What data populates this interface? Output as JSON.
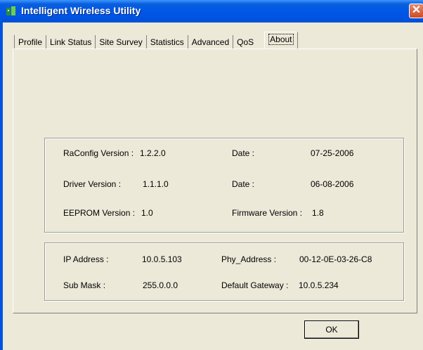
{
  "window": {
    "title": "Intelligent Wireless Utility",
    "close_glyph": "✕"
  },
  "tabs": [
    {
      "label": "Profile"
    },
    {
      "label": "Link Status"
    },
    {
      "label": "Site Survey"
    },
    {
      "label": "Statistics"
    },
    {
      "label": "Advanced"
    },
    {
      "label": "QoS"
    },
    {
      "label": "About"
    }
  ],
  "active_tab": "About",
  "versions": {
    "raconfig_label": "RaConfig Version :",
    "raconfig_value": "1.2.2.0",
    "raconfig_date_label": "Date :",
    "raconfig_date_value": "07-25-2006",
    "driver_label": "Driver Version :",
    "driver_value": "1.1.1.0",
    "driver_date_label": "Date :",
    "driver_date_value": "06-08-2006",
    "eeprom_label": "EEPROM Version :",
    "eeprom_value": "1.0",
    "firmware_label": "Firmware Version :",
    "firmware_value": "1.8"
  },
  "network": {
    "ip_label": "IP Address :",
    "ip_value": "10.0.5.103",
    "phy_label": "Phy_Address :",
    "phy_value": "00-12-0E-03-26-C8",
    "mask_label": "Sub Mask :",
    "mask_value": "255.0.0.0",
    "gateway_label": "Default Gateway :",
    "gateway_value": "10.0.5.234"
  },
  "buttons": {
    "ok": "OK"
  },
  "colors": {
    "titlebar": "#0054e3",
    "face": "#ece9d8",
    "close": "#cf4a25"
  }
}
